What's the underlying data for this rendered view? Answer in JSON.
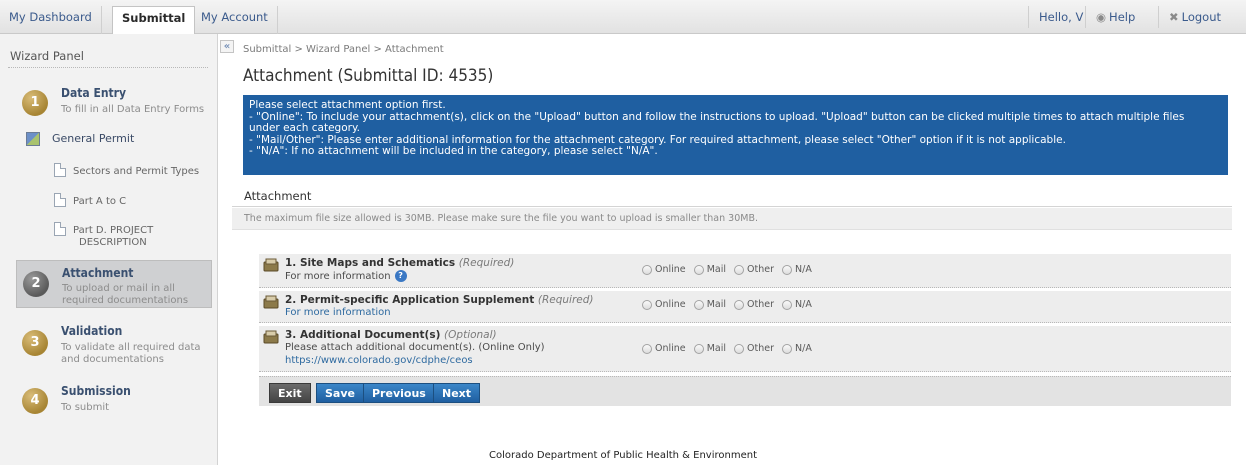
{
  "topnav": {
    "tabs": [
      {
        "label": "My Dashboard"
      },
      {
        "label": "Submittal"
      },
      {
        "label": "My Account"
      }
    ],
    "greeting": "Hello, V",
    "help": "Help",
    "logout": "Logout"
  },
  "sidebar": {
    "title": "Wizard Panel",
    "collapse": "«",
    "steps": [
      {
        "num": "1",
        "title": "Data Entry",
        "desc": "To fill in all Data Entry Forms"
      },
      {
        "num": "2",
        "title": "Attachment",
        "desc1": "To upload or mail in all",
        "desc2": "required documentations"
      },
      {
        "num": "3",
        "title": "Validation",
        "desc1": "To validate all required data",
        "desc2": "and documentations"
      },
      {
        "num": "4",
        "title": "Submission",
        "desc": "To submit"
      }
    ],
    "general_permit": "General Permit",
    "subitems": [
      {
        "label": "Sectors and Permit Types"
      },
      {
        "label": "Part A to C"
      },
      {
        "label1": "Part D. PROJECT",
        "label2": "DESCRIPTION"
      }
    ]
  },
  "main": {
    "breadcrumb": "Submittal > Wizard Panel > Attachment",
    "title": "Attachment (Submittal ID: 4535)",
    "info": [
      "Please select attachment option first.",
      "- \"Online\": To include your attachment(s), click on the \"Upload\" button and follow the instructions to upload. \"Upload\" button can be clicked multiple times to attach multiple files",
      "under each category.",
      "- \"Mail/Other\": Please enter additional information for the attachment category. For required attachment, please select \"Other\" option if it is not applicable.",
      "- \"N/A\": If no attachment will be included in the category, please select \"N/A\"."
    ],
    "section": "Attachment",
    "notice": "The maximum file size allowed is 30MB. Please make sure the file you want to upload is smaller than 30MB.",
    "options": [
      "Online",
      "Mail",
      "Other",
      "N/A"
    ],
    "rows": [
      {
        "title": "1. Site Maps and Schematics",
        "tag": "(Required)",
        "line": "For more information"
      },
      {
        "title": "2. Permit-specific Application Supplement",
        "tag": "(Required)",
        "link": "For more information"
      },
      {
        "title": "3. Additional Document(s)",
        "tag": "(Optional)",
        "line": "Please attach additional document(s). (Online Only)",
        "link": "https://www.colorado.gov/cdphe/ceos"
      }
    ],
    "buttons": {
      "exit": "Exit",
      "save": "Save",
      "previous": "Previous",
      "next": "Next"
    }
  },
  "footer": "Colorado Department of Public Health & Environment",
  "colors": {
    "accent": "#1f5fa1",
    "step_gold": "#a78534",
    "step_active_bg": "#cfd0d2"
  }
}
